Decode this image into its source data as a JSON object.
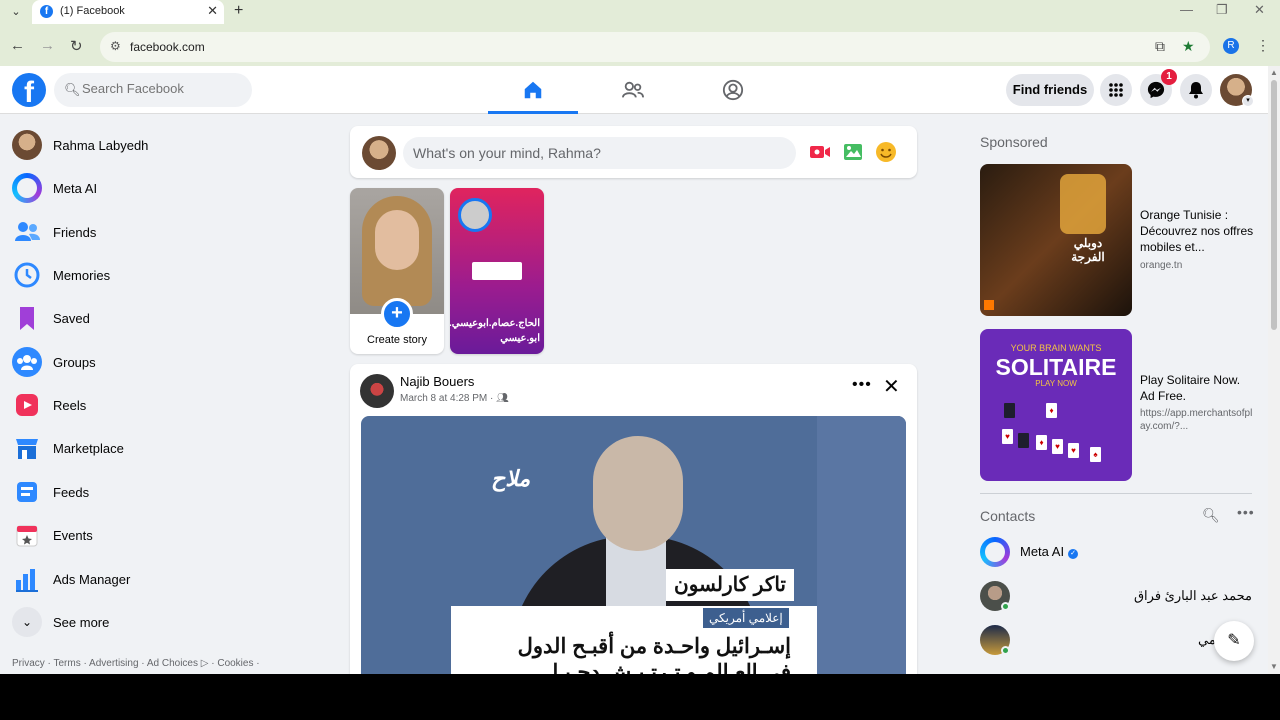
{
  "browser": {
    "tab_title": "(1) Facebook",
    "favicon": "f",
    "url": "facebook.com",
    "profile_initial": "R"
  },
  "topbar": {
    "logo": "f",
    "search_placeholder": "Search Facebook",
    "find_friends": "Find friends",
    "messenger_badge": "1"
  },
  "sidebar": {
    "items": [
      {
        "label": "Rahma Labyedh",
        "icon": "profile-avatar"
      },
      {
        "label": "Meta AI",
        "icon": "meta-ai-icon"
      },
      {
        "label": "Friends",
        "icon": "friends-icon"
      },
      {
        "label": "Memories",
        "icon": "memories-icon"
      },
      {
        "label": "Saved",
        "icon": "saved-icon"
      },
      {
        "label": "Groups",
        "icon": "groups-icon"
      },
      {
        "label": "Reels",
        "icon": "reels-icon"
      },
      {
        "label": "Marketplace",
        "icon": "marketplace-icon"
      },
      {
        "label": "Feeds",
        "icon": "feeds-icon"
      },
      {
        "label": "Events",
        "icon": "events-icon"
      },
      {
        "label": "Ads Manager",
        "icon": "ads-manager-icon"
      },
      {
        "label": "See more",
        "icon": "chevron-down-icon"
      }
    ],
    "footer": "Privacy · Terms · Advertising · Ad Choices ▷ · Cookies ·"
  },
  "composer": {
    "placeholder": "What's on your mind, Rahma?"
  },
  "stories": {
    "create_label": "Create story",
    "story_name": "الحاج.عصام.ابوعيسي. ابو.عيسي"
  },
  "post": {
    "author": "Najib Bouers",
    "meta": "March 8 at 4:28 PM · ",
    "image_logo": "ملاح",
    "image_name": "تاكر كارلسون",
    "image_role": "إعلامي أمريكي",
    "image_headline_1": "إسـرائيل واحـدة من أقبـح الدول",
    "image_headline_2": "في العـالم و تـرتـيـش دحـيـا"
  },
  "right": {
    "sponsored": "Sponsored",
    "ads": [
      {
        "title": "Orange Tunisie : Découvrez nos offres mobiles et...",
        "url": "orange.tn",
        "image_text": "دوبلي الفرجة"
      },
      {
        "title": "Play Solitaire Now. Ad Free.",
        "url": "https://app.merchantsofplay.com/?...",
        "image_top": "YOUR BRAIN WANTS",
        "image_big": "SOLITAIRE",
        "image_play": "PLAY NOW"
      }
    ],
    "contacts_title": "Contacts",
    "contacts": [
      {
        "name": "Meta AI"
      },
      {
        "name": "محمد عبد البارئ فراق"
      },
      {
        "name": "مي"
      }
    ]
  },
  "colors": {
    "brand": "#1877f2",
    "badge": "#e41e3f",
    "online": "#31a24c"
  }
}
